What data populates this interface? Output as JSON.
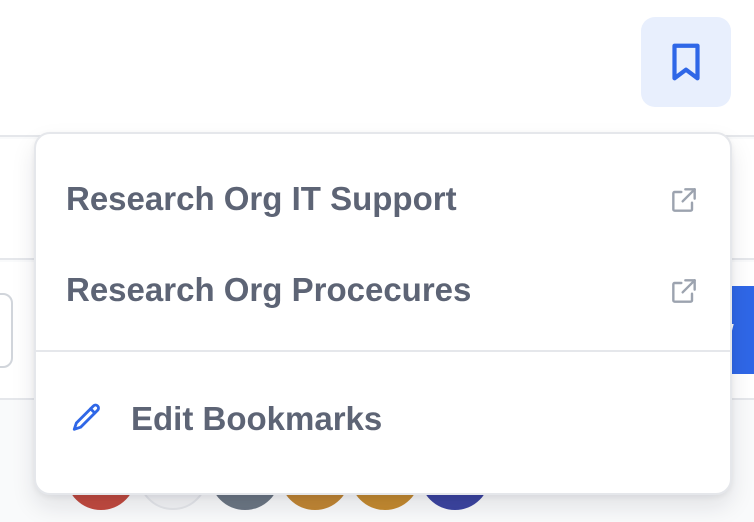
{
  "header": {
    "bookmark_icon": "bookmark-icon",
    "bookmark_button_bg": "#e8effd",
    "accent": "#2f67e7"
  },
  "background": {
    "button_partial_text": "ew",
    "avatar_colors": [
      "#c24a3f",
      "#e5e7eb",
      "#6b7683",
      "#c18633",
      "#c48a2f",
      "#3b44a0"
    ]
  },
  "bookmarks_menu": {
    "items": [
      {
        "label": "Research Org IT Support",
        "icon": "external-link-icon"
      },
      {
        "label": "Research Org Procecures",
        "icon": "external-link-icon"
      }
    ],
    "edit": {
      "label": "Edit Bookmarks",
      "icon": "pencil-icon"
    }
  }
}
